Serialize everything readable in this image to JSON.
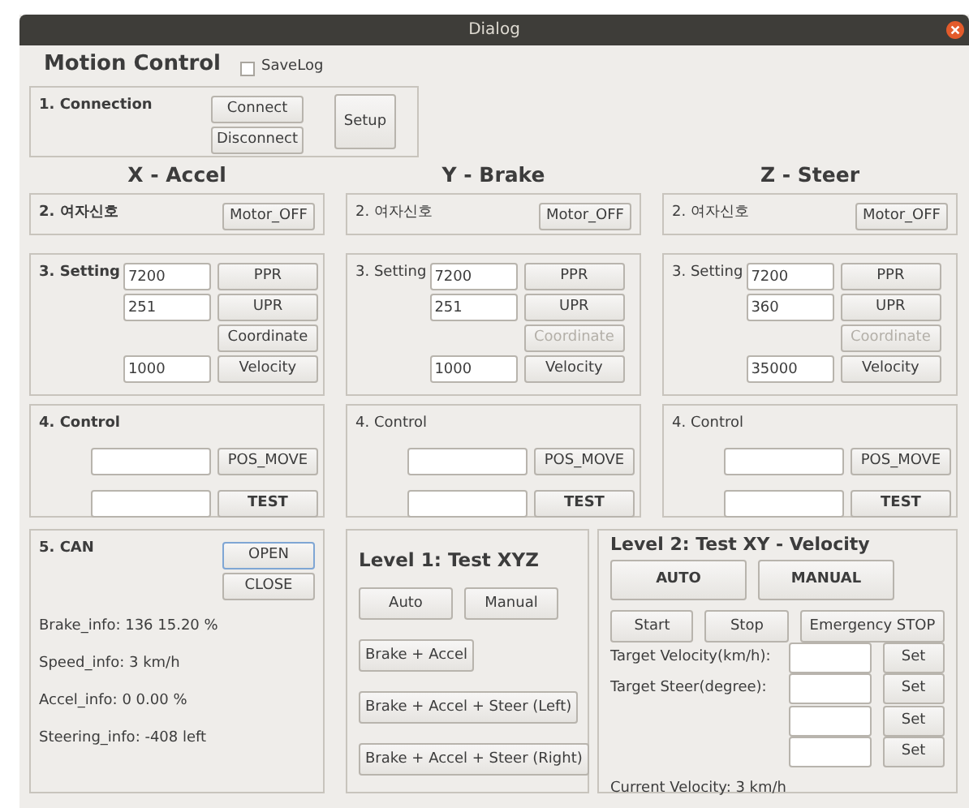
{
  "window": {
    "title": "Dialog"
  },
  "header": {
    "title": "Motion Control",
    "savelog": {
      "label": "SaveLog",
      "checked": false
    }
  },
  "connection": {
    "title": "1. Connection",
    "buttons": [
      "Connect",
      "Disconnect"
    ],
    "setup": "Setup"
  },
  "axes": [
    {
      "heading": "X - Accel",
      "emphasized": true,
      "signal": {
        "label": "2. 여자신호",
        "button": "Motor_OFF"
      },
      "setting": {
        "label": "3. Setting",
        "rows": [
          {
            "kind": "input",
            "value": "7200",
            "button": "PPR",
            "disabled": false
          },
          {
            "kind": "input",
            "value": "251",
            "button": "UPR",
            "disabled": false
          },
          {
            "kind": "button",
            "button": "Coordinate",
            "disabled": false
          },
          {
            "kind": "input",
            "value": "1000",
            "button": "Velocity",
            "disabled": false
          }
        ]
      },
      "control": {
        "label": "4. Control",
        "buttons": [
          {
            "label": "POS_MOVE",
            "bold": false
          },
          {
            "label": "TEST",
            "bold": true
          }
        ]
      }
    },
    {
      "heading": "Y - Brake",
      "emphasized": false,
      "signal": {
        "label": "2. 여자신호",
        "button": "Motor_OFF"
      },
      "setting": {
        "label": "3. Setting",
        "rows": [
          {
            "kind": "input",
            "value": "7200",
            "button": "PPR",
            "disabled": false
          },
          {
            "kind": "input",
            "value": "251",
            "button": "UPR",
            "disabled": false
          },
          {
            "kind": "button",
            "button": "Coordinate",
            "disabled": true
          },
          {
            "kind": "input",
            "value": "1000",
            "button": "Velocity",
            "disabled": false
          }
        ]
      },
      "control": {
        "label": "4. Control",
        "buttons": [
          {
            "label": "POS_MOVE",
            "bold": false
          },
          {
            "label": "TEST",
            "bold": true
          }
        ]
      }
    },
    {
      "heading": "Z - Steer",
      "emphasized": false,
      "signal": {
        "label": "2. 여자신호",
        "button": "Motor_OFF"
      },
      "setting": {
        "label": "3. Setting",
        "rows": [
          {
            "kind": "input",
            "value": "7200",
            "button": "PPR",
            "disabled": false
          },
          {
            "kind": "input",
            "value": "360",
            "button": "UPR",
            "disabled": false
          },
          {
            "kind": "button",
            "button": "Coordinate",
            "disabled": true
          },
          {
            "kind": "input",
            "value": "35000",
            "button": "Velocity",
            "disabled": false
          }
        ]
      },
      "control": {
        "label": "4. Control",
        "buttons": [
          {
            "label": "POS_MOVE",
            "bold": false
          },
          {
            "label": "TEST",
            "bold": true
          }
        ]
      }
    }
  ],
  "can": {
    "title": "5. CAN",
    "buttons": [
      {
        "label": "OPEN",
        "focused": true
      },
      {
        "label": "CLOSE",
        "focused": false
      }
    ],
    "info": [
      "Brake_info: 136 15.20 %",
      "Speed_info: 3 km/h",
      "Accel_info: 0 0.00 %",
      "Steering_info: -408 left"
    ]
  },
  "level1": {
    "title": "Level 1: Test XYZ",
    "mode_buttons": [
      "Auto",
      "Manual"
    ],
    "test_buttons": [
      "Brake + Accel",
      "Brake + Accel + Steer (Left)",
      "Brake + Accel + Steer (Right)"
    ]
  },
  "level2": {
    "title": "Level 2: Test XY - Velocity",
    "mode_buttons": [
      "AUTO",
      "MANUAL"
    ],
    "action_buttons": [
      "Start",
      "Stop",
      "Emergency STOP"
    ],
    "targets": [
      {
        "label": "Target Velocity(km/h):",
        "button": "Set"
      },
      {
        "label": "Target Steer(degree):",
        "button": "Set"
      },
      {
        "button": "Set"
      },
      {
        "button": "Set"
      }
    ],
    "current": "Current Velocity: 3 km/h"
  }
}
